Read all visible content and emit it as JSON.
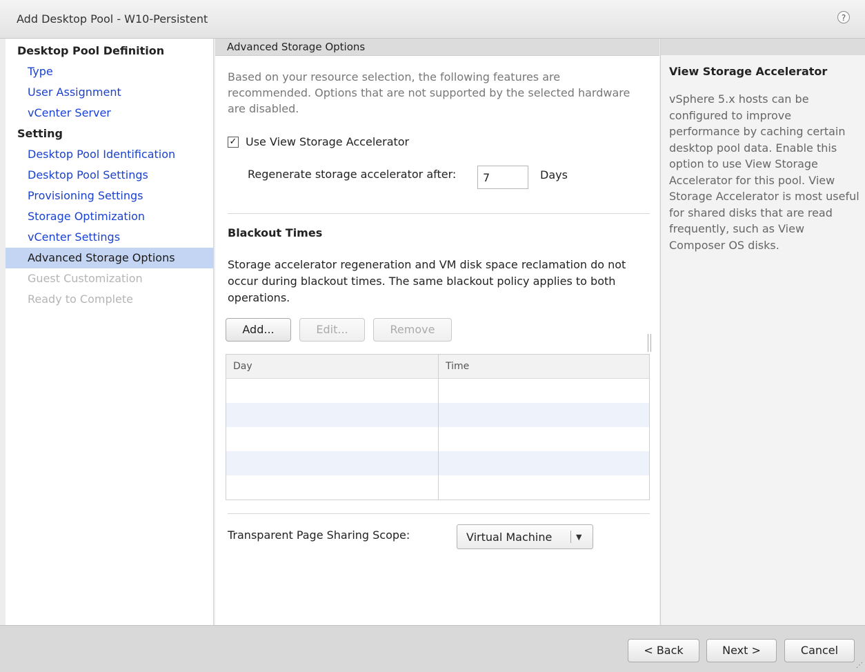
{
  "window": {
    "title": "Add Desktop Pool - W10-Persistent",
    "help_icon": "?"
  },
  "nav": {
    "groups": [
      {
        "label": "Desktop Pool Definition",
        "items": [
          {
            "label": "Type"
          },
          {
            "label": "User Assignment"
          },
          {
            "label": "vCenter Server"
          }
        ]
      },
      {
        "label": "Setting",
        "items": [
          {
            "label": "Desktop Pool Identification"
          },
          {
            "label": "Desktop Pool Settings"
          },
          {
            "label": "Provisioning Settings"
          },
          {
            "label": "Storage Optimization"
          },
          {
            "label": "vCenter Settings"
          },
          {
            "label": "Advanced Storage Options",
            "state": "active"
          },
          {
            "label": "Guest Customization",
            "state": "disabled"
          },
          {
            "label": "Ready to Complete",
            "state": "disabled"
          }
        ]
      }
    ]
  },
  "main": {
    "header": "Advanced Storage Options",
    "intro": "Based on your resource selection, the following features are recommended. Options that are not supported by the selected hardware are disabled.",
    "accelerator": {
      "checkbox_label": "Use View Storage Accelerator",
      "checked": true,
      "check_glyph": "✓",
      "regen_label": "Regenerate storage accelerator after:",
      "regen_value": "7",
      "regen_unit": "Days"
    },
    "blackout": {
      "title": "Blackout Times",
      "description": "Storage accelerator regeneration and VM disk space reclamation do not occur during blackout times. The same blackout policy applies to both operations.",
      "buttons": {
        "add": "Add...",
        "edit": "Edit...",
        "remove": "Remove"
      },
      "columns": [
        "Day",
        "Time"
      ]
    },
    "tps": {
      "label": "Transparent Page Sharing Scope:",
      "selected": "Virtual Machine",
      "arrow": "▼"
    }
  },
  "help": {
    "title": "View Storage Accelerator",
    "body": "vSphere 5.x hosts can be configured to improve performance by caching certain desktop pool data. Enable this option to use View Storage Accelerator for this pool. View Storage Accelerator is most useful for shared disks that are read frequently, such as View Composer OS disks."
  },
  "footer": {
    "back": "< Back",
    "next": "Next >",
    "cancel": "Cancel"
  }
}
